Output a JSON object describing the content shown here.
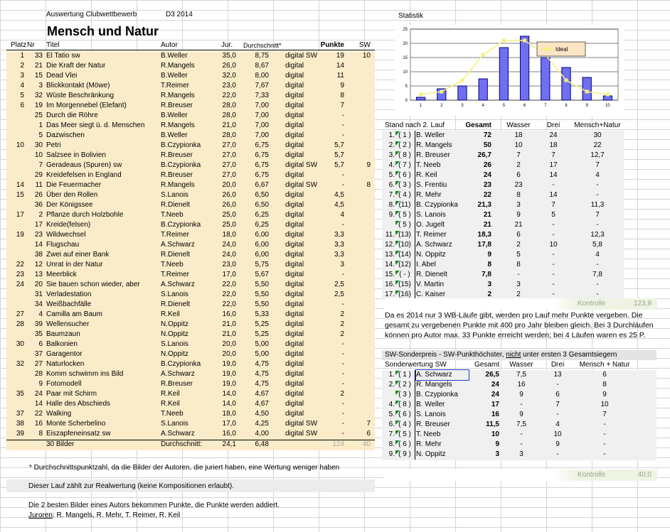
{
  "header": {
    "title_small": "Auswertung Clubwettbewerb",
    "edition": "D3 2014",
    "title_big": "Mensch und Natur"
  },
  "main_table": {
    "columns": [
      "Platz",
      "Nr",
      "Titel",
      "Autor",
      "Jur.",
      "Durchschnitt*",
      "",
      "Punkte",
      "SW"
    ],
    "rows": [
      [
        "1",
        "33",
        "El Tatio sw",
        "B.Weller",
        "35,0",
        "8,75",
        "digital SW",
        "19",
        "10"
      ],
      [
        "2",
        "21",
        "Die Kraft der Natur",
        "R.Mangels",
        "26,0",
        "8,67",
        "digital",
        "14",
        ""
      ],
      [
        "3",
        "15",
        "Dead Vlei",
        "B.Weller",
        "32,0",
        "8,00",
        "digital",
        "11",
        ""
      ],
      [
        "4",
        "3",
        "Blickkontakt (Möwe)",
        "T.Reimer",
        "23,0",
        "7,67",
        "digital",
        "9",
        ""
      ],
      [
        "5",
        "32",
        "Wüste Beschränkung",
        "R.Mangels",
        "22,0",
        "7,33",
        "digital",
        "8",
        ""
      ],
      [
        "6",
        "19",
        "Im Morgennebel (Elefant)",
        "R.Breuser",
        "28,0",
        "7,00",
        "digital",
        "7",
        ""
      ],
      [
        "",
        "25",
        "Durch die Röhre",
        "B.Weller",
        "28,0",
        "7,00",
        "digital",
        "-",
        ""
      ],
      [
        "",
        "1",
        "Das Meer siegt ü. d. Menschen",
        "R.Mangels",
        "21,0",
        "7,00",
        "digital",
        "-",
        ""
      ],
      [
        "",
        "5",
        "Dazwischen",
        "B.Weller",
        "28,0",
        "7,00",
        "digital",
        "-",
        ""
      ],
      [
        "10",
        "30",
        "Petri",
        "B.Czypionka",
        "27,0",
        "6,75",
        "digital",
        "5,7",
        ""
      ],
      [
        "",
        "10",
        "Salzsee in Bolivien",
        "R.Breuser",
        "27,0",
        "6,75",
        "digital",
        "5,7",
        ""
      ],
      [
        "",
        "7",
        "Geradeaus (Spuren) sw",
        "B.Czypionka",
        "27,0",
        "6,75",
        "digital SW",
        "5,7",
        "9"
      ],
      [
        "",
        "29",
        "Kreidefelsen in England",
        "R.Breuser",
        "27,0",
        "6,75",
        "digital",
        "-",
        ""
      ],
      [
        "14",
        "11",
        "Die Feuermacher",
        "R.Mangels",
        "20,0",
        "6,67",
        "digital SW",
        "-",
        "8"
      ],
      [
        "15",
        "26",
        "Über den Rollen",
        "S.Lanois",
        "26,0",
        "6,50",
        "digital",
        "4,5",
        ""
      ],
      [
        "",
        "36",
        "Der Königssee",
        "R.Dienelt",
        "26,0",
        "6,50",
        "digital",
        "4,5",
        ""
      ],
      [
        "17",
        "2",
        "Pflanze durch Holzbohle",
        "T.Neeb",
        "25,0",
        "6,25",
        "digital",
        "4",
        ""
      ],
      [
        "",
        "17",
        "Kreide(felsen)",
        "B.Czypionka",
        "25,0",
        "6,25",
        "digital",
        "-",
        ""
      ],
      [
        "19",
        "23",
        "Wildwechsel",
        "T.Reimer",
        "18,0",
        "6,00",
        "digital",
        "3,3",
        ""
      ],
      [
        "",
        "14",
        "Flugschau",
        "A.Schwarz",
        "24,0",
        "6,00",
        "digital",
        "3,3",
        ""
      ],
      [
        "",
        "38",
        "Zwei auf einer Bank",
        "R.Dienelt",
        "24,0",
        "6,00",
        "digital",
        "3,3",
        ""
      ],
      [
        "22",
        "12",
        "Unrat in der Natur",
        "T.Neeb",
        "23,0",
        "5,75",
        "digital",
        "3",
        ""
      ],
      [
        "23",
        "13",
        "Meerblick",
        "T.Reimer",
        "17,0",
        "5,67",
        "digital",
        "-",
        ""
      ],
      [
        "24",
        "20",
        "Sie bauen schon wieder, aber",
        "A.Schwarz",
        "22,0",
        "5,50",
        "digital",
        "2,5",
        ""
      ],
      [
        "",
        "31",
        "Verladestation",
        "S.Lanois",
        "22,0",
        "5,50",
        "digital",
        "2,5",
        ""
      ],
      [
        "",
        "34",
        "Weißbachfälle",
        "R.Dienelt",
        "22,0",
        "5,50",
        "digital",
        "-",
        ""
      ],
      [
        "27",
        "4",
        "Camilla am Baum",
        "R.Keil",
        "16,0",
        "5,33",
        "digital",
        "2",
        ""
      ],
      [
        "28",
        "39",
        "Wellensucher",
        "N.Oppitz",
        "21,0",
        "5,25",
        "digital",
        "2",
        ""
      ],
      [
        "",
        "35",
        "Baumzaun",
        "N.Oppitz",
        "21,0",
        "5,25",
        "digital",
        "2",
        ""
      ],
      [
        "30",
        "6",
        "Balkonien",
        "S.Lanois",
        "20,0",
        "5,00",
        "digital",
        "-",
        ""
      ],
      [
        "",
        "37",
        "Garagentor",
        "N.Oppitz",
        "20,0",
        "5,00",
        "digital",
        "-",
        ""
      ],
      [
        "32",
        "27",
        "Naturlocken",
        "B.Czypionka",
        "19,0",
        "4,75",
        "digital",
        "-",
        ""
      ],
      [
        "",
        "28",
        "Komm schwimm ins Bild",
        "A.Schwarz",
        "19,0",
        "4,75",
        "digital",
        "-",
        ""
      ],
      [
        "",
        "9",
        "Fotomodell",
        "R.Breuser",
        "19,0",
        "4,75",
        "digital",
        "-",
        ""
      ],
      [
        "35",
        "24",
        "Paar mit Schirm",
        "R.Keil",
        "14,0",
        "4,67",
        "digital",
        "2",
        ""
      ],
      [
        "",
        "14",
        "Halle des Abschieds",
        "R.Keil",
        "14,0",
        "4,67",
        "digital",
        "-",
        ""
      ],
      [
        "37",
        "22",
        "Walking",
        "T.Neeb",
        "18,0",
        "4,50",
        "digital",
        "-",
        ""
      ],
      [
        "38",
        "16",
        "Monte Scherbelino",
        "S.Lanois",
        "17,0",
        "4,25",
        "digital SW",
        "-",
        "7"
      ],
      [
        "39",
        "8",
        "Eiszapfeneinsatz sw",
        "A.Schwarz",
        "16,0",
        "4,00",
        "digital SW",
        "-",
        "6"
      ]
    ],
    "footer": {
      "count": "30 Bilder",
      "avg_label": "Durchschnitt:",
      "jur_avg": "24,1",
      "avg": "6,48",
      "points_sum": "124",
      "sw_sum": "40"
    }
  },
  "notes": {
    "footnote": "* Durchschnittspunktzahl, da die Bilder der Autoren, die juriert haben, eine Wertung weniger haben",
    "realwertung": "Dieser Lauf zählt zur Realwertung (keine Kompositionen erlaubt).",
    "best_two": "Die 2 besten Bilder eines Autors bekommen Punkte, die Punkte werden addiert.",
    "jurors_label": "Juroren",
    "jurors": ": R. Mangels, R. Mehr, T. Reimer, R. Keil"
  },
  "chart_data": {
    "type": "bar",
    "title": "Statistik",
    "categories": [
      "1",
      "2",
      "3",
      "4",
      "5",
      "6",
      "7",
      "8",
      "9",
      "10"
    ],
    "series": [
      {
        "name": "",
        "type": "bar",
        "values": [
          1,
          4,
          5,
          7.5,
          18.5,
          22.5,
          15,
          11.5,
          8,
          1.5
        ]
      },
      {
        "name": "Ideal",
        "type": "line",
        "values": [
          2,
          3,
          7,
          16,
          21,
          21,
          16,
          7,
          3,
          2
        ]
      }
    ],
    "ylim": [
      0,
      25
    ],
    "yticks": [
      "0",
      "5",
      "10",
      "15",
      "20",
      "25"
    ],
    "grid": true,
    "legend": "center-right",
    "colors": {
      "bar": "#6f6ff0",
      "bar_edge": "#000080",
      "line": "#f6f07a",
      "legend_bg": "#fce5c4"
    }
  },
  "standings": {
    "title": "Stand nach 2. Lauf",
    "columns": [
      "Gesamt",
      "Wasser",
      "Drei",
      "Mensch+Natur"
    ],
    "rows": [
      [
        "1.",
        "( 1 )",
        "B. Weller",
        "72",
        "18",
        "24",
        "30"
      ],
      [
        "2.",
        "( 2 )",
        "R. Mangels",
        "50",
        "10",
        "18",
        "22"
      ],
      [
        "3.",
        "( 8 )",
        "R. Breuser",
        "26,7",
        "7",
        "7",
        "12,7"
      ],
      [
        "4.",
        "( 7 )",
        "T. Neeb",
        "26",
        "2",
        "17",
        "7"
      ],
      [
        "5.",
        "( 6 )",
        "R. Keil",
        "24",
        "6",
        "14",
        "4"
      ],
      [
        "6.",
        "( 3 )",
        "S. Frentiu",
        "23",
        "23",
        "-",
        "-"
      ],
      [
        "7.",
        "( 4 )",
        "R. Mehr",
        "22",
        "8",
        "14",
        "-"
      ],
      [
        "8.",
        "(11)",
        "B. Czypionka",
        "21,3",
        "3",
        "7",
        "11,3"
      ],
      [
        "9.",
        "( 5 )",
        "S. Lanois",
        "21",
        "9",
        "5",
        "7"
      ],
      [
        "",
        "( 5 )",
        "O. Jugelt",
        "21",
        "21",
        "-",
        "-"
      ],
      [
        "11.",
        "(13)",
        "T. Reimer",
        "18,3",
        "6",
        "-",
        "12,3"
      ],
      [
        "12.",
        "(10)",
        "A. Schwarz",
        "17,8",
        "2",
        "10",
        "5,8"
      ],
      [
        "13.",
        "(14)",
        "N. Oppitz",
        "9",
        "5",
        "-",
        "4"
      ],
      [
        "14.",
        "(12)",
        "I. Abel",
        "8",
        "8",
        "-",
        "-"
      ],
      [
        "15.",
        "( - )",
        "R. Dienelt",
        "7,8",
        "-",
        "-",
        "7,8"
      ],
      [
        "16.",
        "(15)",
        "V. Martin",
        "3",
        "3",
        "-",
        "-"
      ],
      [
        "17.",
        "(16)",
        "C. Kaiser",
        "2",
        "2",
        "-",
        "-"
      ]
    ],
    "kontrolle_label": "Kontrolle",
    "kontrolle_value": "123,9"
  },
  "info_text": [
    "Da es 2014 nur 3 WB-Läufe gibt, werden pro Lauf mehr Punkte vergeben. Die",
    "gesamt zu vergebenen Punkte mit 400 pro Jahr bleiben gleich. Bei 3 Durchläufen",
    "können pro Autor max. 33 Punkte erreicht werden; bei 4 Läufen waren es 25 P."
  ],
  "sonderpreis": {
    "title_a": "SW-Sonderpreis - SW-Punkthöchster, ",
    "title_u": "nicht",
    "title_b": " unter ersten 3 Gesamtsiegern",
    "columns": [
      "Sonderwertung SW",
      "Gesamt",
      "Wasser",
      "Drei",
      "Mensch + Natur"
    ],
    "rows": [
      [
        "1.",
        "( 1 )",
        "A. Schwarz",
        "26,5",
        "7,5",
        "13",
        "6"
      ],
      [
        "2.",
        "( 2 )",
        "R. Mangels",
        "24",
        "16",
        "-",
        "8"
      ],
      [
        "",
        "( 3 )",
        "B. Czypionka",
        "24",
        "9",
        "6",
        "9"
      ],
      [
        "4.",
        "( 8 )",
        "B. Weller",
        "17",
        "-",
        "7",
        "10"
      ],
      [
        "5.",
        "( 6 )",
        "S. Lanois",
        "16",
        "9",
        "-",
        "7"
      ],
      [
        "6.",
        "( 4 )",
        "R. Breuser",
        "11,5",
        "7,5",
        "4",
        "-"
      ],
      [
        "7.",
        "( 5 )",
        "T. Neeb",
        "10",
        "-",
        "10",
        "-"
      ],
      [
        "8.",
        "( 6 )",
        "R. Mehr",
        "9",
        "-",
        "9",
        "-"
      ],
      [
        "9.",
        "( 9 )",
        "N. Oppitz",
        "3",
        "3",
        "-",
        "-"
      ]
    ],
    "kontrolle_label": "Kontrolle",
    "kontrolle_value": "40,0"
  }
}
